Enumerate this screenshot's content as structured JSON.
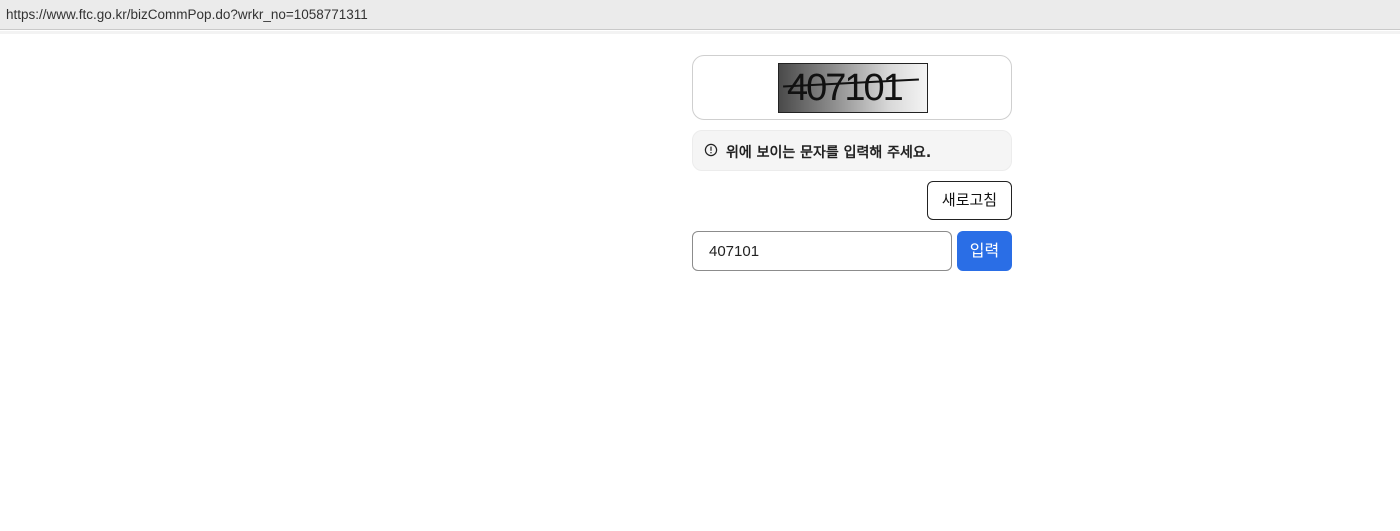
{
  "browser": {
    "url": "https://www.ftc.go.kr/bizCommPop.do?wrkr_no=1058771311"
  },
  "captcha": {
    "image_text": "407101"
  },
  "notice": {
    "icon": "info-circle-icon",
    "text": "위에 보이는 문자를 입력해 주세요."
  },
  "buttons": {
    "refresh_label": "새로고침",
    "submit_label": "입력"
  },
  "input": {
    "value": "407101",
    "placeholder": ""
  },
  "colors": {
    "submit_bg": "#2a6ee6",
    "notice_bg": "#f5f5f5"
  }
}
